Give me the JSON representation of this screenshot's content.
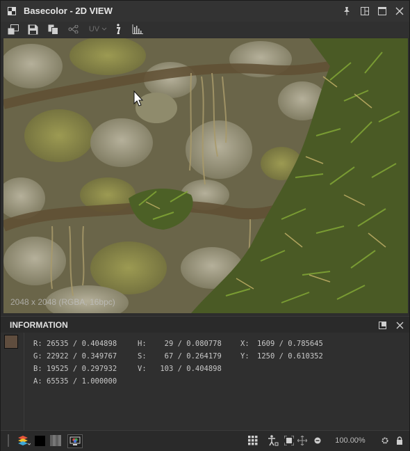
{
  "window": {
    "title": "Basecolor - 2D VIEW"
  },
  "toolbar": {
    "uv_label": "UV"
  },
  "viewport": {
    "resolution_info": "2048 x 2048 (RGBA, 16bpc)"
  },
  "info_panel": {
    "title": "INFORMATION",
    "swatch_color": "#5f4d3e",
    "rgba": [
      {
        "label": "R:",
        "value": "26535 / 0.404898"
      },
      {
        "label": "G:",
        "value": "22922 / 0.349767"
      },
      {
        "label": "B:",
        "value": "19525 / 0.297932"
      },
      {
        "label": "A:",
        "value": "65535 / 1.000000"
      }
    ],
    "hsv": [
      {
        "label": "H:",
        "value": "  29 / 0.080778"
      },
      {
        "label": "S:",
        "value": "  67 / 0.264179"
      },
      {
        "label": "V:",
        "value": " 103 / 0.404898"
      }
    ],
    "xy": [
      {
        "label": "X:",
        "value": "1609 / 0.785645"
      },
      {
        "label": "Y:",
        "value": "1250 / 0.610352"
      }
    ]
  },
  "bottom_bar": {
    "zoom": "100.00%"
  }
}
